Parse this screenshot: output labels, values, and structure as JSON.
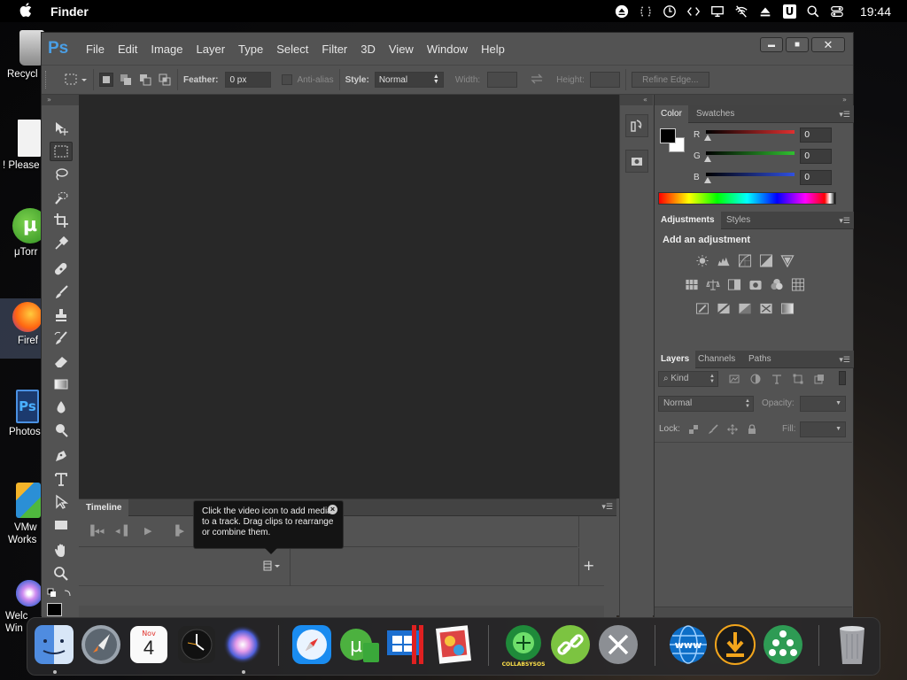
{
  "menubar": {
    "app_name": "Finder",
    "time": "19:44",
    "input_badge": "U"
  },
  "desktop_icons": [
    {
      "label": "Recycl"
    },
    {
      "label": "! Please"
    },
    {
      "label": "μTorr"
    },
    {
      "label": "Firef"
    },
    {
      "label": "Photos"
    },
    {
      "label": "VMw"
    },
    {
      "label": "Works"
    },
    {
      "label": "Welc"
    },
    {
      "label": "Win"
    }
  ],
  "photoshop": {
    "logo": "Ps",
    "menus": [
      "File",
      "Edit",
      "Image",
      "Layer",
      "Type",
      "Select",
      "Filter",
      "3D",
      "View",
      "Window",
      "Help"
    ],
    "window_buttons": {
      "minimize": "▬",
      "maximize": "■",
      "close": "✕"
    },
    "options": {
      "feather_label": "Feather:",
      "feather_value": "0 px",
      "antialias_label": "Anti-alias",
      "style_label": "Style:",
      "style_value": "Normal",
      "width_label": "Width:",
      "height_label": "Height:",
      "refine_label": "Refine Edge..."
    },
    "timeline": {
      "tab": "Timeline",
      "tooltip": "Click the video icon to add media to a track. Drag clips to rearrange or combine them.",
      "add_symbol": "+"
    },
    "color_panel": {
      "tabs": [
        "Color",
        "Swatches"
      ],
      "channels": [
        {
          "label": "R",
          "value": "0",
          "color": "#e03030"
        },
        {
          "label": "G",
          "value": "0",
          "color": "#30c030"
        },
        {
          "label": "B",
          "value": "0",
          "color": "#3050e0"
        }
      ]
    },
    "adjustments_panel": {
      "tabs": [
        "Adjustments",
        "Styles"
      ],
      "heading": "Add an adjustment"
    },
    "layers_panel": {
      "tabs": [
        "Layers",
        "Channels",
        "Paths"
      ],
      "kind_label": "Kind",
      "blend_mode": "Normal",
      "opacity_label": "Opacity:",
      "lock_label": "Lock:",
      "fill_label": "Fill:"
    }
  },
  "dock": {
    "calendar_month": "Nov",
    "calendar_day": "4",
    "collabsysos_label": "COLLABSYSOS"
  }
}
